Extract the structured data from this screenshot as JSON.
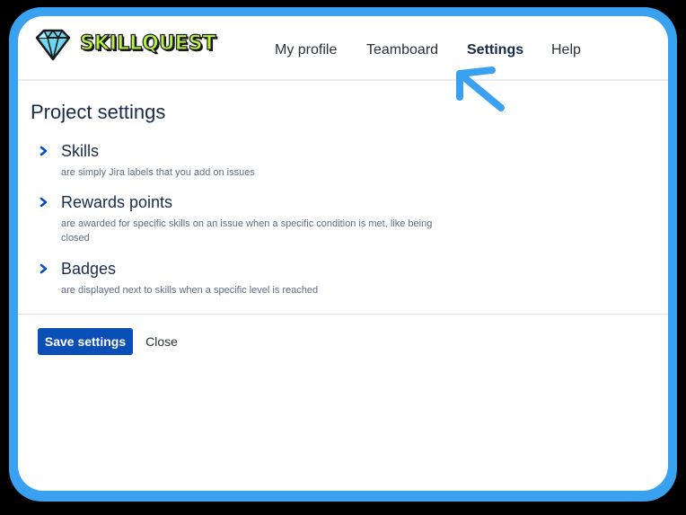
{
  "brand": {
    "name": "SKILLQUEST"
  },
  "nav": {
    "items": [
      {
        "label": "My profile"
      },
      {
        "label": "Teamboard"
      },
      {
        "label": "Settings",
        "active": true
      },
      {
        "label": "Help"
      }
    ]
  },
  "page": {
    "title": "Project settings",
    "sections": [
      {
        "title": "Skills",
        "description": "are simply Jira labels that you add on issues"
      },
      {
        "title": "Rewards points",
        "description": "are awarded for specific skills on an issue when a specific condition is met, like being closed"
      },
      {
        "title": "Badges",
        "description": "are displayed next to skills when a specific level is reached"
      }
    ]
  },
  "actions": {
    "save_label": "Save settings",
    "close_label": "Close"
  },
  "colors": {
    "frame": "#3aa0f0",
    "primary_button": "#0a4fb8",
    "logo_text": "#b8f04a",
    "chevron": "#0a4fb8"
  },
  "icons": {
    "logo": "diamond-icon",
    "section_toggle": "chevron-right-icon",
    "callout": "arrow-pointer-icon"
  }
}
